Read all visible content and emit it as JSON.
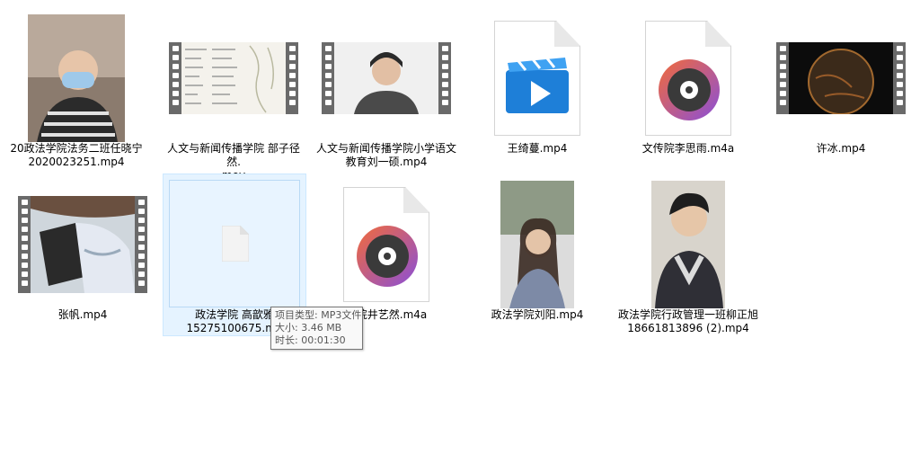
{
  "files": [
    {
      "label": "20政法学院法务二班任晓宁\n2020023251.mp4"
    },
    {
      "label": "人文与新闻传播学院 部子径然.\nmov"
    },
    {
      "label": "人文与新闻传播学院小学语文\n教育刘一硕.mp4"
    },
    {
      "label": "王绮蔓.mp4"
    },
    {
      "label": "文传院李思雨.m4a"
    },
    {
      "label": "许冰.mp4"
    },
    {
      "label": "张帆.mp4"
    },
    {
      "label": "政法学院 高歆雅\n15275100675.mp"
    },
    {
      "label": "学院井艺然.m4a"
    },
    {
      "label": "政法学院刘阳.mp4"
    },
    {
      "label": "政法学院行政管理一班柳正旭\n18661813896 (2).mp4"
    }
  ],
  "tooltip": {
    "type": "项目类型: MP3文件",
    "size": "大小: 3.46 MB",
    "duration": "时长: 00:01:30"
  },
  "colors": {
    "selection_bg": "#e5f3ff",
    "video_icon_blue": "#1e7fd8",
    "media_icon_orange": "#f26b3a",
    "media_icon_purple": "#8a4fd8"
  }
}
